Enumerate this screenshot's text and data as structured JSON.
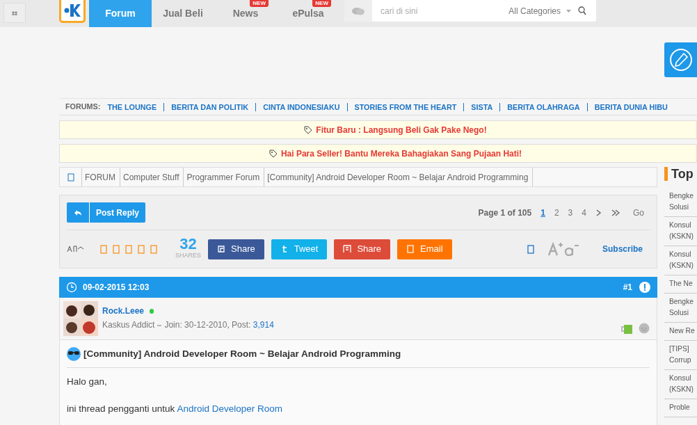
{
  "topnav": {
    "tabs": [
      {
        "label": "Forum",
        "selected": true
      },
      {
        "label": "Jual Beli",
        "selected": false
      },
      {
        "label": "News",
        "selected": false,
        "badge": "NEW"
      },
      {
        "label": "ePulsa",
        "selected": false,
        "badge": "NEW"
      }
    ],
    "search": {
      "placeholder": "cari di sini",
      "category": "All Categories"
    }
  },
  "forums_bar": {
    "label": "FORUMS:",
    "links": [
      "THE LOUNGE",
      "BERITA DAN POLITIK",
      "CINTA INDONESIAKU",
      "STORIES FROM THE HEART",
      "SISTA",
      "BERITA OLAHRAGA",
      "BERITA DUNIA HIBU"
    ]
  },
  "notices": [
    "Fitur Baru : Langsung Beli Gak Pake Nego!",
    "Hai Para Seller! Bantu Mereka Bahagiakan Sang Pujaan Hati!"
  ],
  "breadcrumb": [
    "FORUM",
    "Computer Stuff",
    "Programmer Forum",
    "[Community] Android Developer Room ~ Belajar Android Programming"
  ],
  "toolbar": {
    "post_reply": "Post Reply",
    "page_label": "Page 1 of 105",
    "pages": [
      {
        "label": "1",
        "selected": true
      },
      {
        "label": "2",
        "selected": false
      },
      {
        "label": "3",
        "selected": false
      },
      {
        "label": "4",
        "selected": false
      }
    ],
    "go": "Go",
    "share_count": "32",
    "shares_label": "SHARES",
    "share_buttons": [
      {
        "kind": "facebook",
        "label": "Share",
        "color": "#3b5998"
      },
      {
        "kind": "twitter",
        "label": "Tweet",
        "color": "#12b1ea"
      },
      {
        "kind": "google",
        "label": "Share",
        "color": "#dd4b39"
      },
      {
        "kind": "email",
        "label": "Email",
        "color": "#ff7400"
      }
    ],
    "subscribe": "Subscribe"
  },
  "post": {
    "date": "09-02-2015 12:03",
    "number": "#1",
    "username": "Rock.Leee",
    "online": true,
    "rank": "Kaskus Addict",
    "join": "Join: 30-12-2010, Post: ",
    "post_count": "3,914",
    "title": "[Community] Android Developer Room ~ Belajar Android Programming",
    "body": [
      {
        "text": "Halo gan,"
      },
      {
        "text": "ini thread pengganti untuk ",
        "link": "Android Developer Room"
      }
    ]
  },
  "sidebar": {
    "title": "Top",
    "items": [
      [
        "Bengke",
        "Solusi"
      ],
      [
        "Konsul",
        "(KSKN)"
      ],
      [
        "Konsul",
        "(KSKN)"
      ],
      [
        "The Ne"
      ],
      [
        "Bengke",
        "Solusi"
      ],
      [
        "New Re"
      ],
      [
        "[TIPS]",
        "Corrup"
      ],
      [
        "Konsul",
        "(KSKN)"
      ],
      [
        "Proble"
      ]
    ]
  }
}
